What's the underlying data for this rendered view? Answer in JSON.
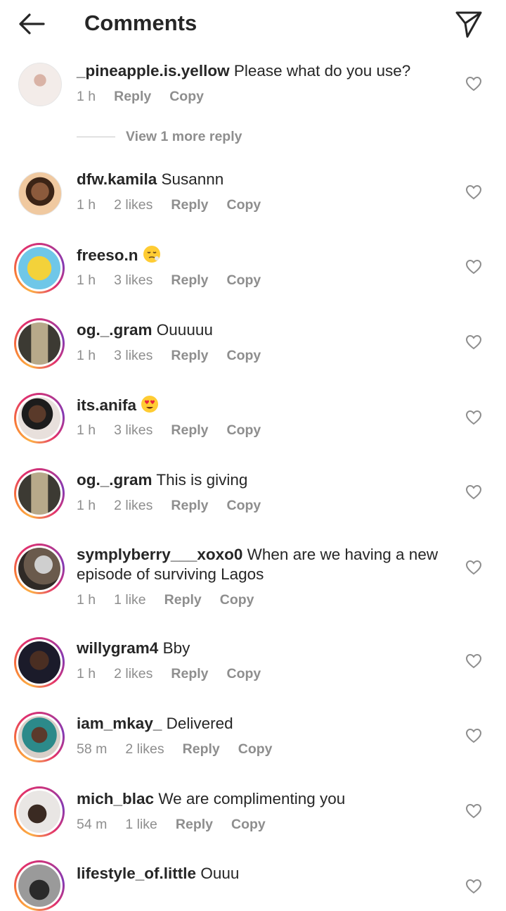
{
  "header": {
    "title": "Comments"
  },
  "icons": {
    "back": "arrow-left-icon",
    "share": "paper-plane-icon",
    "like": "heart-outline-icon"
  },
  "colors": {
    "text": "#262626",
    "secondary": "#8e8e8e",
    "story_ring_start": "#fcaf45",
    "story_ring_end": "#c13584"
  },
  "view_more_replies": "View 1 more reply",
  "comments": [
    {
      "username": "_pineapple.is.yellow",
      "text": "Please what do you use?",
      "time": "1 h",
      "likes": "",
      "reply": "Reply",
      "copy": "Copy"
    },
    {
      "username": "dfw.kamila",
      "text": "Susannn",
      "time": "1 h",
      "likes": "2 likes",
      "reply": "Reply",
      "copy": "Copy"
    },
    {
      "username": "freeso.n",
      "text": "",
      "emoji": "face-with-steam-icon",
      "time": "1 h",
      "likes": "3 likes",
      "reply": "Reply",
      "copy": "Copy"
    },
    {
      "username": "og._.gram",
      "text": "Ouuuuu",
      "time": "1 h",
      "likes": "3 likes",
      "reply": "Reply",
      "copy": "Copy"
    },
    {
      "username": "its.anifa",
      "text": "",
      "emoji": "heart-eyes-icon",
      "time": "1 h",
      "likes": "3 likes",
      "reply": "Reply",
      "copy": "Copy"
    },
    {
      "username": "og._.gram",
      "text": "This is giving",
      "time": "1 h",
      "likes": "2 likes",
      "reply": "Reply",
      "copy": "Copy"
    },
    {
      "username": "symplyberry___xoxo0",
      "text": "When are we having a new episode of surviving Lagos",
      "time": "1 h",
      "likes": "1 like",
      "reply": "Reply",
      "copy": "Copy"
    },
    {
      "username": "willygram4",
      "text": "Bby",
      "time": "1 h",
      "likes": "2 likes",
      "reply": "Reply",
      "copy": "Copy"
    },
    {
      "username": "iam_mkay_",
      "text": "Delivered",
      "time": "58 m",
      "likes": "2 likes",
      "reply": "Reply",
      "copy": "Copy"
    },
    {
      "username": "mich_blac",
      "text": "We are complimenting you",
      "time": "54 m",
      "likes": "1 like",
      "reply": "Reply",
      "copy": "Copy"
    },
    {
      "username": "lifestyle_of.little",
      "text": "Ouuu",
      "time": "",
      "likes": "",
      "reply": "",
      "copy": ""
    }
  ]
}
